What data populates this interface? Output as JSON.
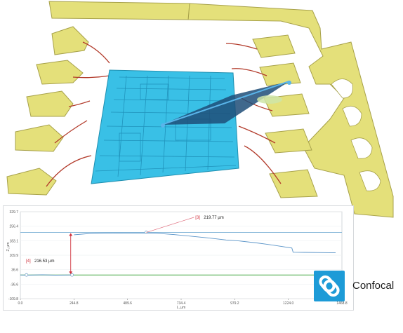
{
  "product": {
    "name": "Confocal",
    "badge_color": "#1d9bd7",
    "badge_icon": "confocal-link-icon"
  },
  "scene": {
    "description_colors": {
      "leadframe": "#e4e07a",
      "die": "#39c0e6",
      "profile_plane": "#1e4e78",
      "wire": "#b23a2a"
    }
  },
  "chart_data": {
    "type": "line",
    "title": "",
    "xlabel": "L, µm",
    "ylabel": "Z, µm",
    "xlim": [
      0,
      1468.8
    ],
    "ylim": [
      -109.8,
      329.7
    ],
    "x_ticks": [
      "0.0",
      "244.8",
      "489.6",
      "734.4",
      "979.2",
      "1224.0",
      "1468.8"
    ],
    "y_ticks": [
      "329.7",
      "256.4",
      "183.1",
      "109.9",
      "36.6",
      "-36.6",
      "-109.8"
    ],
    "reference_lines": [
      {
        "name": "upper",
        "y": 225,
        "color": "#86b6d8"
      },
      {
        "name": "lower",
        "y": 10,
        "color": "#46a845"
      }
    ],
    "series": [
      {
        "color": "#5a94c8",
        "x": [
          0,
          30,
          100,
          160,
          230
        ],
        "y": [
          10,
          9,
          11,
          9,
          10
        ]
      },
      {
        "color": "#5a94c8",
        "x": [
          245,
          300,
          380,
          470,
          560,
          620,
          700,
          780,
          860,
          940,
          1000,
          1080,
          1160,
          1240,
          1246,
          1300,
          1380,
          1440
        ],
        "y": [
          213,
          218,
          221,
          222,
          222,
          221,
          214,
          206,
          197,
          187,
          182,
          172,
          160,
          146,
          125,
          124,
          123,
          122
        ]
      }
    ],
    "markers": [
      {
        "x": 28,
        "y": 10
      },
      {
        "x": 236,
        "y": 10
      },
      {
        "x": 575,
        "y": 225
      }
    ],
    "annotations": [
      {
        "id": "[3]",
        "value": "219.77 µm"
      },
      {
        "id": "[4]",
        "value": "216.53 µm"
      }
    ]
  }
}
